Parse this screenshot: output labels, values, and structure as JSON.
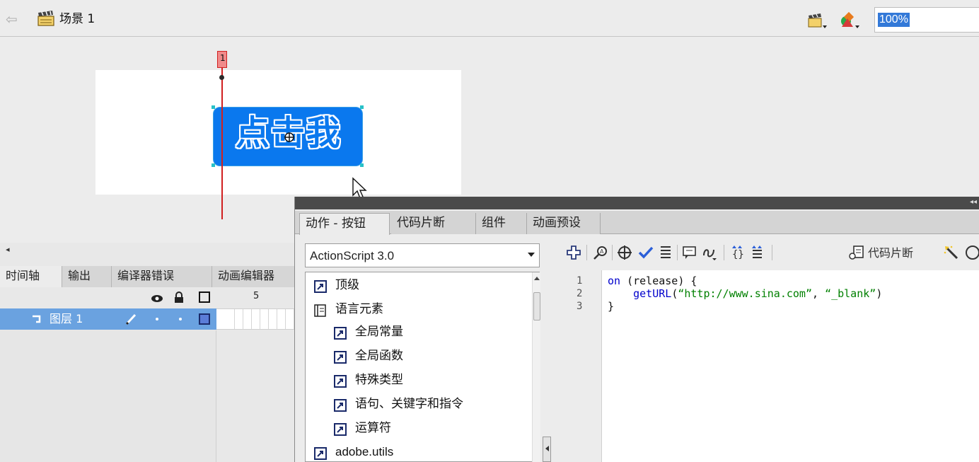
{
  "top_bar": {
    "scene_label": "场景 1",
    "zoom": "100%"
  },
  "stage": {
    "button_text": "点击我"
  },
  "timeline": {
    "tabs": [
      "时间轴",
      "输出",
      "编译器错误",
      "动画编辑器"
    ],
    "frame_numbers": [
      "1",
      "5"
    ],
    "playhead_frame": "1",
    "layer_name": "图层 1"
  },
  "actions_panel": {
    "tabs": [
      "动作 - 按钮",
      "代码片断",
      "组件",
      "动画预设"
    ],
    "script_version": "ActionScript 3.0",
    "tree_items": [
      {
        "label": "顶级",
        "icon": "book-icon"
      },
      {
        "label": "语言元素",
        "icon": "open-book-icon"
      },
      {
        "label": "全局常量",
        "icon": "book-icon"
      },
      {
        "label": "全局函数",
        "icon": "book-icon"
      },
      {
        "label": "特殊类型",
        "icon": "book-icon"
      },
      {
        "label": "语句、关键字和指令",
        "icon": "book-icon"
      },
      {
        "label": "运算符",
        "icon": "book-icon"
      },
      {
        "label": "adobe.utils",
        "icon": "book-icon"
      }
    ],
    "toolbar_snippet_label": "代码片断",
    "code": {
      "line_numbers": [
        "1",
        "2",
        "3"
      ],
      "line1": {
        "kw": "on",
        "rest": " (release) {"
      },
      "line2": {
        "indent": "    ",
        "fn": "getURL",
        "open": "(",
        "arg1": "“http://www.sina.com”",
        "sep": ", ",
        "arg2": "“_blank”",
        "close": ")"
      },
      "line3": "}"
    }
  },
  "colors": {
    "button_blue": "#0a78ee",
    "selection_blue": "#3379d8",
    "layer_row_blue": "#6aa2e0",
    "playhead_red": "#d12020"
  }
}
